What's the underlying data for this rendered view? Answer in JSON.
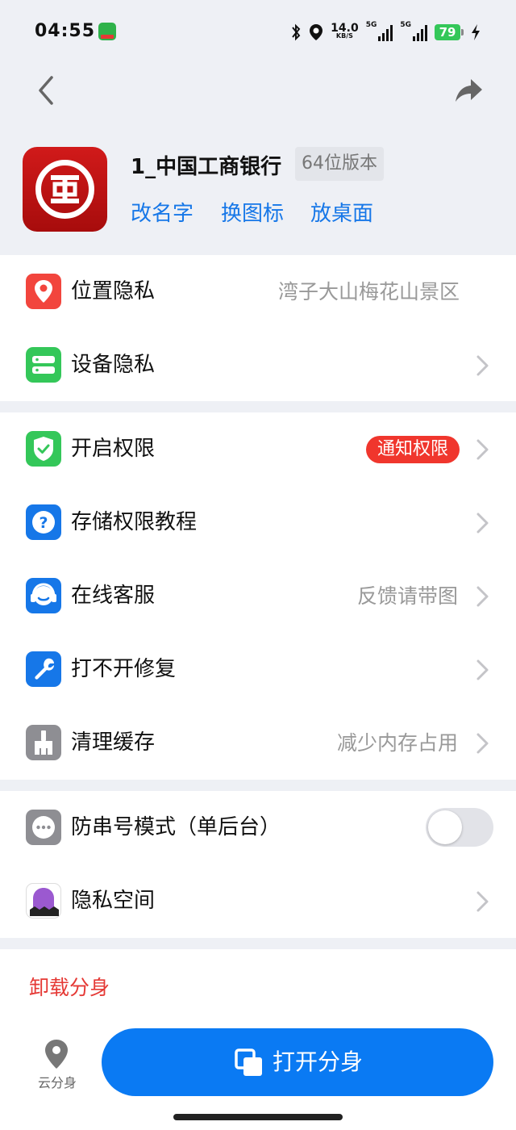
{
  "status_bar": {
    "time": "04:55",
    "speed": "14.0",
    "speed_unit": "KB/S",
    "net1": "5G",
    "net2": "5G",
    "battery": "79"
  },
  "app": {
    "name": "1_中国工商银行",
    "version": "64位版本",
    "actions": [
      "改名字",
      "换图标",
      "放桌面"
    ]
  },
  "section1": [
    {
      "label": "位置隐私",
      "value": "湾子大山梅花山景区",
      "icon": "location-pin-icon",
      "color": "#f2453d"
    },
    {
      "label": "设备隐私",
      "value": "",
      "icon": "device-icon",
      "color": "#34c759"
    }
  ],
  "section2": [
    {
      "label": "开启权限",
      "badge": "通知权限",
      "icon": "shield-check-icon",
      "color": "#34c759"
    },
    {
      "label": "存储权限教程",
      "value": "",
      "icon": "question-icon",
      "color": "#1677e8"
    },
    {
      "label": "在线客服",
      "value": "反馈请带图",
      "icon": "headset-icon",
      "color": "#1677e8"
    },
    {
      "label": "打不开修复",
      "value": "",
      "icon": "wrench-icon",
      "color": "#1677e8"
    },
    {
      "label": "清理缓存",
      "value": "减少内存占用",
      "icon": "broom-icon",
      "color": "#8e8e93"
    }
  ],
  "section3": [
    {
      "label": "防串号模式（单后台）",
      "toggle": false,
      "icon": "dots-icon",
      "color": "#8e8e93"
    },
    {
      "label": "隐私空间",
      "value": "",
      "icon": "ghost-icon",
      "color": "#9b59d0"
    }
  ],
  "bottom": {
    "uninstall": "卸载分身",
    "cloud_label": "云分身",
    "open_label": "打开分身"
  },
  "colors": {
    "accent": "#1677e8",
    "primary_button": "#0a7af3",
    "danger": "#e53935",
    "background": "#eef0f5"
  }
}
